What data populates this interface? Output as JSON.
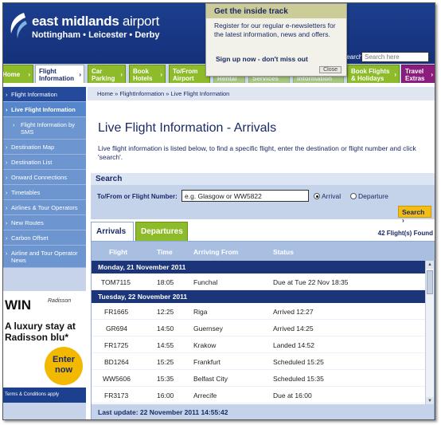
{
  "header": {
    "logo_name_bold": "east midlands",
    "logo_name_light": " airport",
    "logo_sub": "Nottingham • Leicester • Derby",
    "search_label": "Search",
    "search_placeholder": "Search here"
  },
  "popup": {
    "title": "Get the inside track",
    "body": "Register for our regular e-newsletters for the latest information, news and offers.",
    "link": "Sign up now - don't miss out",
    "close": "Close"
  },
  "nav": {
    "tabs": [
      {
        "label": "Home"
      },
      {
        "label": "Flight Information"
      },
      {
        "label": "Car Parking"
      },
      {
        "label": "Book Hotels"
      },
      {
        "label": "To/From Airport"
      },
      {
        "label": "Car Rental"
      },
      {
        "label": "Airport Services"
      },
      {
        "label": "Airline Information"
      },
      {
        "label": "Book Flights & Holidays"
      },
      {
        "label": "Travel Extras"
      }
    ]
  },
  "sidebar": {
    "items": [
      {
        "label": "Flight Information"
      },
      {
        "label": "Live Flight Information"
      },
      {
        "label": "Flight Information by SMS"
      },
      {
        "label": "Destination Map"
      },
      {
        "label": "Destination List"
      },
      {
        "label": "Onward Connections"
      },
      {
        "label": "Timetables"
      },
      {
        "label": "Airlines & Tour Operators"
      },
      {
        "label": "New Routes"
      },
      {
        "label": "Carbon Offset"
      },
      {
        "label": "Airline and Tour Operator News"
      }
    ],
    "ad": {
      "win": "WIN",
      "brand": "Radisson",
      "text": "A luxury stay at Radisson blu*",
      "cta": "Enter now",
      "terms": "Terms & Conditions apply"
    }
  },
  "main": {
    "breadcrumb": "Home » FlightInformation » Live Flight Information",
    "title": "Live Flight Information - Arrivals",
    "intro": "Live flight information is listed below, to find a specific flight, enter the destination or flight number and click 'search'.",
    "search": {
      "heading": "Search",
      "label": "To/From or Flight Number:",
      "value": "e.g. Glasgow or WW5822",
      "radio_arrival": "Arrival",
      "radio_departure": "Departure",
      "button": "Search"
    },
    "tabs": {
      "arrivals": "Arrivals",
      "departures": "Departures"
    },
    "flight_count": "42 Flight(s) Found",
    "columns": {
      "flight": "Flight",
      "time": "Time",
      "from": "Arriving From",
      "status": "Status"
    },
    "groups": [
      {
        "date": "Monday, 21 November 2011",
        "flights": [
          {
            "flight": "TOM7115",
            "time": "18:05",
            "from": "Funchal",
            "status": "Due at Tue 22 Nov 18:35"
          }
        ]
      },
      {
        "date": "Tuesday, 22 November 2011",
        "flights": [
          {
            "flight": "FR1665",
            "time": "12:25",
            "from": "Riga",
            "status": "Arrived 12:27"
          },
          {
            "flight": "GR694",
            "time": "14:50",
            "from": "Guernsey",
            "status": "Arrived 14:25"
          },
          {
            "flight": "FR1725",
            "time": "14:55",
            "from": "Krakow",
            "status": "Landed 14:52"
          },
          {
            "flight": "BD1264",
            "time": "15:25",
            "from": "Frankfurt",
            "status": "Scheduled 15:25"
          },
          {
            "flight": "WW5606",
            "time": "15:35",
            "from": "Belfast City",
            "status": "Scheduled 15:35"
          },
          {
            "flight": "FR3173",
            "time": "16:00",
            "from": "Arrecife",
            "status": "Due at 16:00"
          }
        ]
      }
    ],
    "last_update": "Last update: 22 November 2011 14:55:42"
  },
  "colors": {
    "brand_blue": "#1c3f8e",
    "tab_green": "#8dbb2a",
    "tab_purple": "#8b1d7c",
    "search_yellow": "#f3bd16",
    "date_row": "#1c3478"
  }
}
